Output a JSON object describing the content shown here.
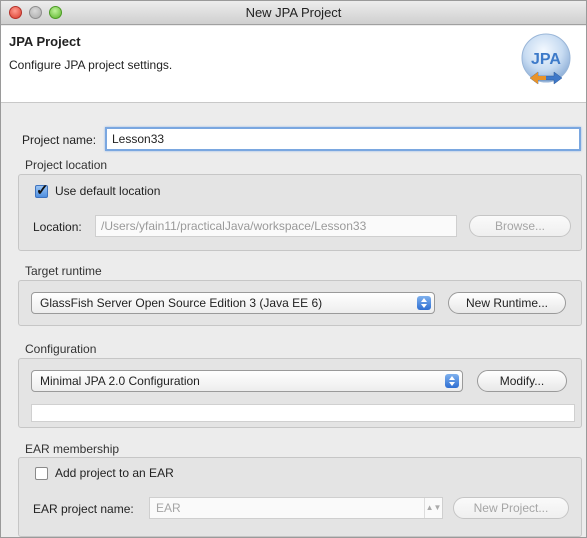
{
  "window": {
    "title": "New JPA Project"
  },
  "header": {
    "title": "JPA Project",
    "subtitle": "Configure JPA project settings.",
    "logo_text": "JPA"
  },
  "project_name": {
    "label": "Project name:",
    "value": "Lesson33"
  },
  "project_location": {
    "group_title": "Project location",
    "use_default_label": "Use default location",
    "use_default_checked": true,
    "location_label": "Location:",
    "location_value": "/Users/yfain11/practicalJava/workspace/Lesson33",
    "browse_label": "Browse..."
  },
  "target_runtime": {
    "group_title": "Target runtime",
    "selected": "GlassFish Server Open Source Edition 3 (Java EE 6)",
    "new_runtime_label": "New Runtime..."
  },
  "configuration": {
    "group_title": "Configuration",
    "selected": "Minimal JPA 2.0 Configuration",
    "modify_label": "Modify..."
  },
  "ear_membership": {
    "group_title": "EAR membership",
    "add_to_ear_label": "Add project to an EAR",
    "add_to_ear_checked": false,
    "ear_name_label": "EAR project name:",
    "ear_name_value": "EAR",
    "new_project_label": "New Project..."
  }
}
